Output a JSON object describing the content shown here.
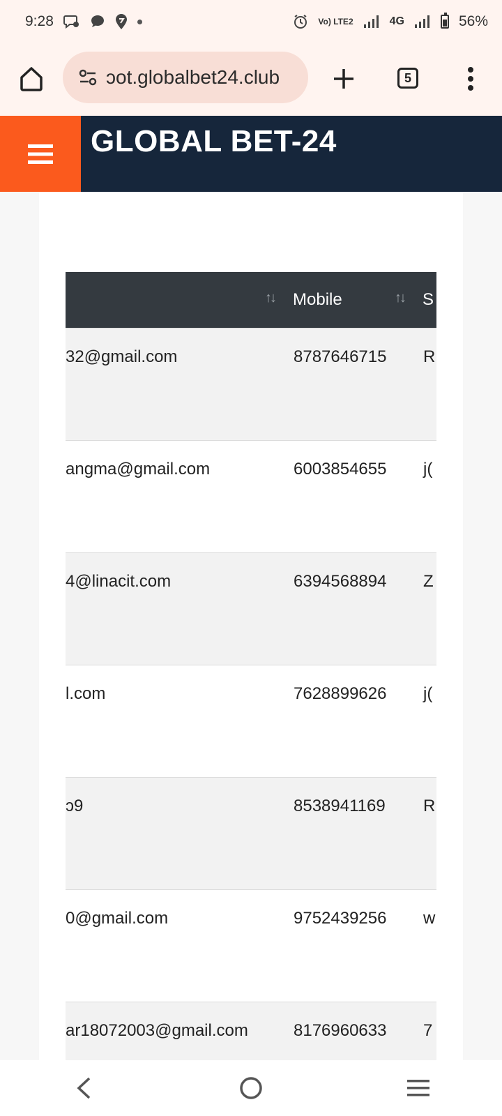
{
  "status_bar": {
    "time": "9:28",
    "network_label": "4G",
    "volte_label": "Vo) LTE2",
    "battery": "56%"
  },
  "browser": {
    "url": "ɔot.globalbet24.club",
    "tab_count": "5"
  },
  "site": {
    "title": "GLOBAL BET-24"
  },
  "table": {
    "headers": [
      "",
      "Mobile",
      "S"
    ],
    "rows": [
      {
        "email": "32@gmail.com",
        "mobile": "8787646715",
        "s": "R"
      },
      {
        "email": "angma@gmail.com",
        "mobile": "6003854655",
        "s": "j("
      },
      {
        "email": "4@linacit.com",
        "mobile": "6394568894",
        "s": "Z"
      },
      {
        "email": "l.com",
        "mobile": "7628899626",
        "s": "j("
      },
      {
        "email": "ɔ9",
        "mobile": "8538941169",
        "s": "R"
      },
      {
        "email": "0@gmail.com",
        "mobile": "9752439256",
        "s": "w"
      },
      {
        "email": "ar18072003@gmail.com",
        "mobile": "8176960633",
        "s": "7"
      }
    ]
  }
}
